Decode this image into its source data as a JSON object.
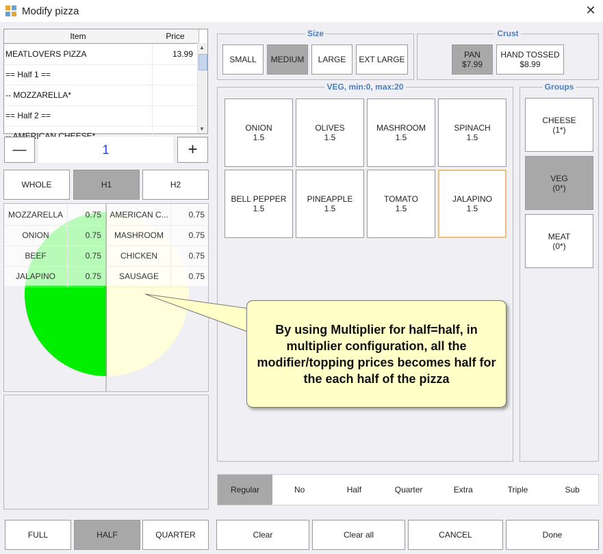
{
  "window": {
    "title": "Modify pizza",
    "close_glyph": "✕"
  },
  "order_table": {
    "headers": [
      "Item",
      "Price"
    ],
    "rows": [
      {
        "item": "MEATLOVERS PIZZA",
        "price": "13.99"
      },
      {
        "item": "== Half 1 ==",
        "price": ""
      },
      {
        "item": "-- MOZZARELLA*",
        "price": ""
      },
      {
        "item": "== Half 2 ==",
        "price": ""
      },
      {
        "item": "-- AMERICAN CHEESE*",
        "price": ""
      }
    ]
  },
  "quantity": {
    "minus": "—",
    "value": "1",
    "plus": "+"
  },
  "portion_tabs": [
    {
      "label": "WHOLE",
      "selected": false
    },
    {
      "label": "H1",
      "selected": true
    },
    {
      "label": "H2",
      "selected": false
    }
  ],
  "half1_toppings": [
    {
      "name": "MOZZARELLA",
      "price": "0.75"
    },
    {
      "name": "ONION",
      "price": "0.75"
    },
    {
      "name": "BEEF",
      "price": "0.75"
    },
    {
      "name": "JALAPINO",
      "price": "0.75"
    }
  ],
  "half2_toppings": [
    {
      "name": "AMERICAN C...",
      "price": "0.75"
    },
    {
      "name": "MASHROOM",
      "price": "0.75"
    },
    {
      "name": "CHICKEN",
      "price": "0.75"
    },
    {
      "name": "SAUSAGE",
      "price": "0.75"
    }
  ],
  "size": {
    "label": "Size",
    "options": [
      {
        "label": "SMALL",
        "selected": false
      },
      {
        "label": "MEDIUM",
        "selected": true
      },
      {
        "label": "LARGE",
        "selected": false
      },
      {
        "label": "EXT LARGE",
        "selected": false
      }
    ]
  },
  "crust": {
    "label": "Crust",
    "options": [
      {
        "name": "PAN",
        "price": "$7.99",
        "selected": true
      },
      {
        "name": "HAND TOSSED",
        "price": "$8.99",
        "selected": false
      }
    ]
  },
  "veg": {
    "label": "VEG, min:0, max:20",
    "items": [
      {
        "name": "ONION",
        "price": "1.5",
        "highlight": false
      },
      {
        "name": "OLIVES",
        "price": "1.5",
        "highlight": false
      },
      {
        "name": "MASHROOM",
        "price": "1.5",
        "highlight": false
      },
      {
        "name": "SPINACH",
        "price": "1.5",
        "highlight": false
      },
      {
        "name": "BELL PEPPER",
        "price": "1.5",
        "highlight": false
      },
      {
        "name": "PINEAPPLE",
        "price": "1.5",
        "highlight": false
      },
      {
        "name": "TOMATO",
        "price": "1.5",
        "highlight": false
      },
      {
        "name": "JALAPINO",
        "price": "1.5",
        "highlight": true
      }
    ]
  },
  "groups": {
    "label": "Groups",
    "items": [
      {
        "name": "CHEESE",
        "count": "(1*)",
        "selected": false
      },
      {
        "name": "VEG",
        "count": "(0*)",
        "selected": true
      },
      {
        "name": "MEAT",
        "count": "(0*)",
        "selected": false
      }
    ]
  },
  "callout": {
    "text": "By using Multiplier for half=half, in multiplier configuration, all the modifier/topping prices becomes half for the each half of the pizza"
  },
  "modifiers": [
    {
      "label": "Regular",
      "selected": true
    },
    {
      "label": "No",
      "selected": false
    },
    {
      "label": "Half",
      "selected": false
    },
    {
      "label": "Quarter",
      "selected": false
    },
    {
      "label": "Extra",
      "selected": false
    },
    {
      "label": "Triple",
      "selected": false
    },
    {
      "label": "Sub",
      "selected": false
    }
  ],
  "split_buttons": [
    {
      "label": "FULL",
      "selected": false
    },
    {
      "label": "HALF",
      "selected": true
    },
    {
      "label": "QUARTER",
      "selected": false
    }
  ],
  "actions": [
    "Clear",
    "Clear all",
    "CANCEL",
    "Done"
  ],
  "colors": {
    "accent": "#4a7fc0",
    "selected": "#a8a8a8",
    "half1_fill": "#00ee00",
    "half2_fill": "#ffffdc",
    "qty_text": "#1f3fd6",
    "callout_bg": "#ffffc8",
    "highlight_border": "#e8c27a"
  }
}
